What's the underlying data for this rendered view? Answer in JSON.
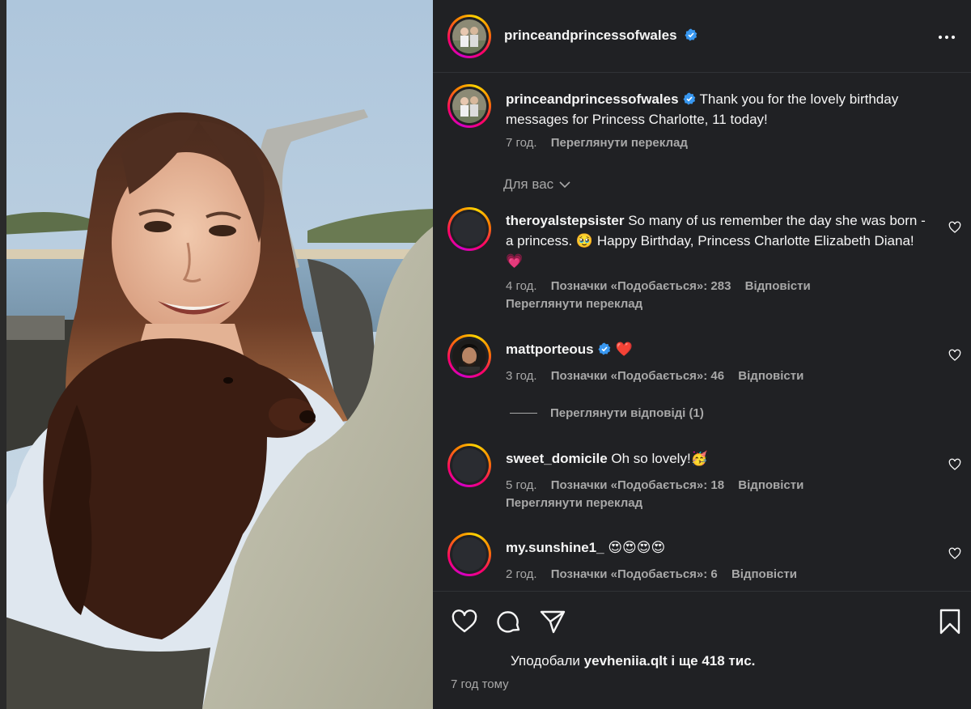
{
  "post": {
    "author": "princeandprincessofwales",
    "caption": "Thank you for the lovely birthday messages for Princess Charlotte, 11 today!",
    "caption_time": "7 год.",
    "translate_label": "Переглянути переклад"
  },
  "filter": {
    "label": "Для вас"
  },
  "comments": [
    {
      "username": "theroyalstepsister",
      "text": "So many of us remember the day she was born - a princess. 🥹 Happy Birthday, Princess Charlotte Elizabeth Diana! 💗",
      "time": "4 год.",
      "likes": "Позначки «Подобається»: 283",
      "reply": "Відповісти",
      "translate": "Переглянути переклад"
    },
    {
      "username": "mattporteous",
      "text": "❤️",
      "time": "3 год.",
      "likes": "Позначки «Подобається»: 46",
      "reply": "Відповісти",
      "view_replies": "Переглянути відповіді (1)"
    },
    {
      "username": "sweet_domicile",
      "text": "Oh so lovely!🥳",
      "time": "5 год.",
      "likes": "Позначки «Подобається»: 18",
      "reply": "Відповісти",
      "translate": "Переглянути переклад"
    },
    {
      "username": "my.sunshine1_",
      "text": "😍😍😍😍",
      "time": "2 год.",
      "likes": "Позначки «Подобається»: 6",
      "reply": "Відповісти"
    }
  ],
  "footer": {
    "liked_prefix": "Уподобали",
    "liked_user": "yevheniia.qlt",
    "liked_suffix": "і ще 418 тис.",
    "time_ago": "7 год тому"
  },
  "icons": [
    "more-icon",
    "verified-icon",
    "chevron-down-icon",
    "heart-icon",
    "comment-icon",
    "share-icon",
    "bookmark-icon"
  ],
  "colors": {
    "panel_bg": "#202124",
    "text": "#f5f5f5",
    "muted": "#a8a8a8",
    "verified": "#3897f0"
  }
}
